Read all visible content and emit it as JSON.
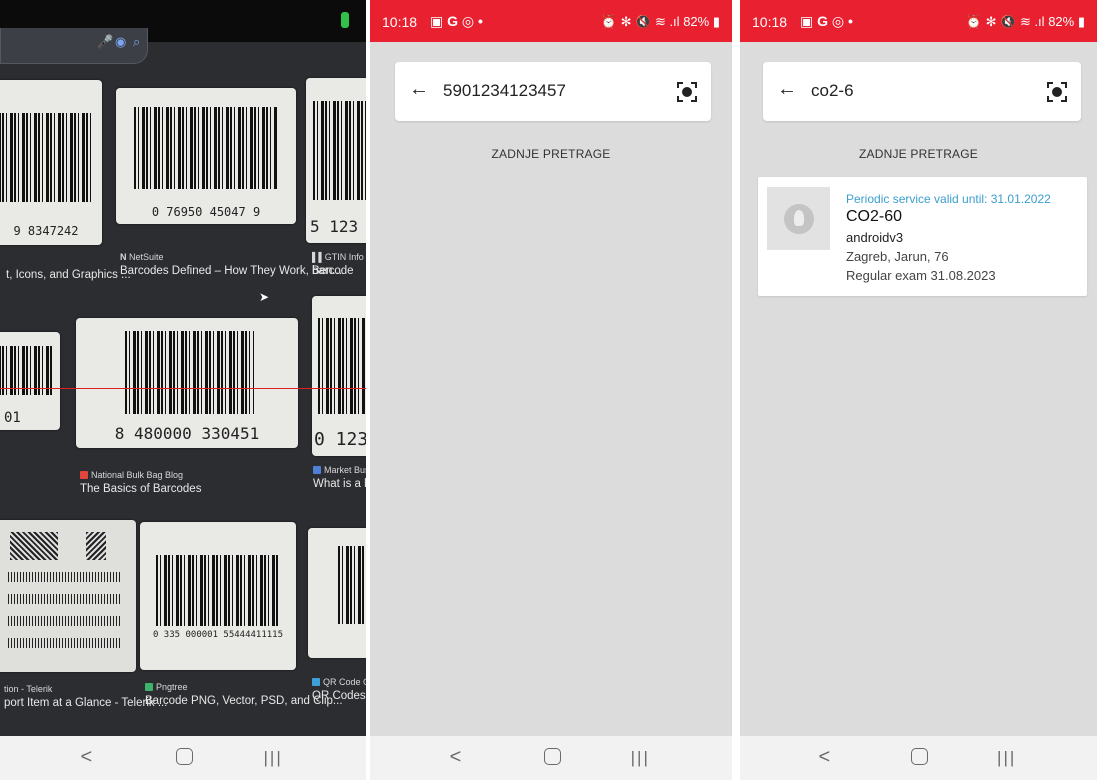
{
  "camera": {
    "cards": [
      {
        "number": "9 8347242",
        "source": "",
        "title": "t, Icons, and Graphics ..."
      },
      {
        "number": "0 76950 45047 9",
        "source": "NetSuite",
        "title": "Barcodes Defined – How They Work, Ben..."
      },
      {
        "number": "5 123",
        "source": "GTIN Info",
        "title": "barcode"
      },
      {
        "number": "01",
        "source": "",
        "title": ""
      },
      {
        "number": "8 480000 330451",
        "source": "National Bulk Bag Blog",
        "title": "The Basics of Barcodes"
      },
      {
        "number": "0 123",
        "source": "Market Busin",
        "title": "What is a bar"
      },
      {
        "number": "",
        "source": "tion - Telerik",
        "title": "port Item at a Glance - Telerik ..."
      },
      {
        "number": "0 335 000001 55444411115",
        "source": "Pngtree",
        "title": "Barcode PNG, Vector, PSD, and Clip..."
      },
      {
        "number": "",
        "source": "QR Code Gen",
        "title": "QR Codes vs"
      }
    ]
  },
  "status": {
    "time": "10:18",
    "battery": "82%",
    "status_icons": "⏰ ✻ 🔇 ≋ .ıl"
  },
  "screen1": {
    "query": "5901234123457",
    "recent_label": "ZADNJE PRETRAGE"
  },
  "screen2": {
    "query": "co2-6",
    "recent_label": "ZADNJE PRETRAGE",
    "result": {
      "service": "Periodic service valid until: 31.01.2022",
      "name": "CO2-60",
      "owner": "androidv3",
      "address": "Zagreb, Jarun, 76",
      "exam": "Regular exam 31.08.2023"
    }
  },
  "colors": {
    "status_bar": "#e82030",
    "accent": "#3b9ecf",
    "background": "#dcdcdc"
  }
}
